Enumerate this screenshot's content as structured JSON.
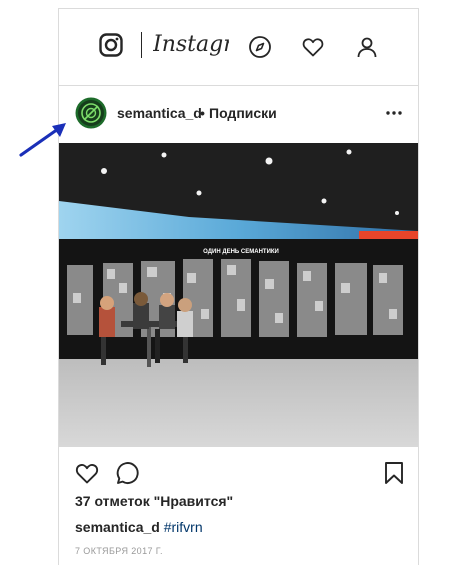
{
  "topbar": {
    "wordmark": "Instagram",
    "icons": [
      "instagram-logo-icon",
      "compass-icon",
      "heart-icon",
      "profile-icon"
    ]
  },
  "post": {
    "username": "semantica_d",
    "separator": "•",
    "follow_label": "Подписки",
    "photo_sign": "ОДИН  ДЕНЬ  СЕМАНТИКИ",
    "likes": "37 отметок \"Нравится\"",
    "caption_user": "semantica_d",
    "caption_tag": "#rifvrn",
    "date": "7 ОКТЯБРЯ 2017 Г."
  },
  "colors": {
    "text": "#262626",
    "border": "#dbdbdb",
    "hashtag": "#003569",
    "date": "#999999",
    "annotation_arrow": "#1a2fb8",
    "avatar_ring": "#1d6b2a"
  }
}
